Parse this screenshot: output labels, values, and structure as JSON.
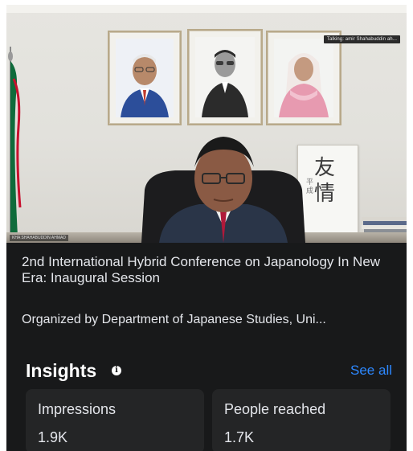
{
  "video": {
    "caption_badge": "Talking: amir Shahabuddin ah...",
    "name_tag": "KHA SHAHABUDDIN AHMAD",
    "calligraphy_main": "友\n情",
    "calligraphy_side": "平成"
  },
  "post": {
    "title": "2nd International Hybrid Conference on Japanology In New Era: Inaugural Session",
    "organizer": "Organized by Department of Japanese Studies, Uni..."
  },
  "insights": {
    "title": "Insights",
    "info_icon": "info-icon",
    "see_all": "See all",
    "cards": [
      {
        "label": "Impressions",
        "value": "1.9K"
      },
      {
        "label": "People reached",
        "value": "1.7K"
      }
    ]
  },
  "colors": {
    "background": "#18191a",
    "card": "#242526",
    "text": "#e4e6eb",
    "link": "#2d88ff"
  }
}
